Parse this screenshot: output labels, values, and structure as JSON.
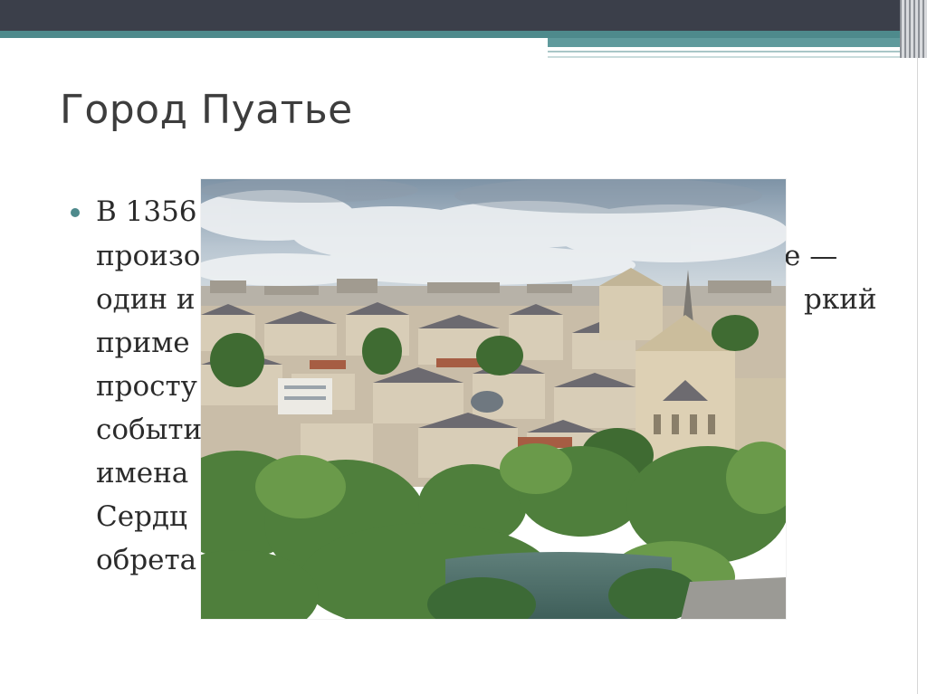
{
  "slide": {
    "title": "Город Пуатье",
    "bullet_lines": [
      "В 1356",
      "произо",
      "один и",
      "приме",
      "просту",
      "событи",
      "имена",
      "Сердц",
      "обрета"
    ],
    "bullet_tail_line2": "е —",
    "bullet_tail_line3": "ркий"
  },
  "photo": {
    "subject": "panorama-of-poitiers"
  },
  "colors": {
    "top_bar": "#3b3f4a",
    "accent_teal": "#4e8a8c",
    "text": "#2b2b2b",
    "title": "#3d3d3d"
  }
}
